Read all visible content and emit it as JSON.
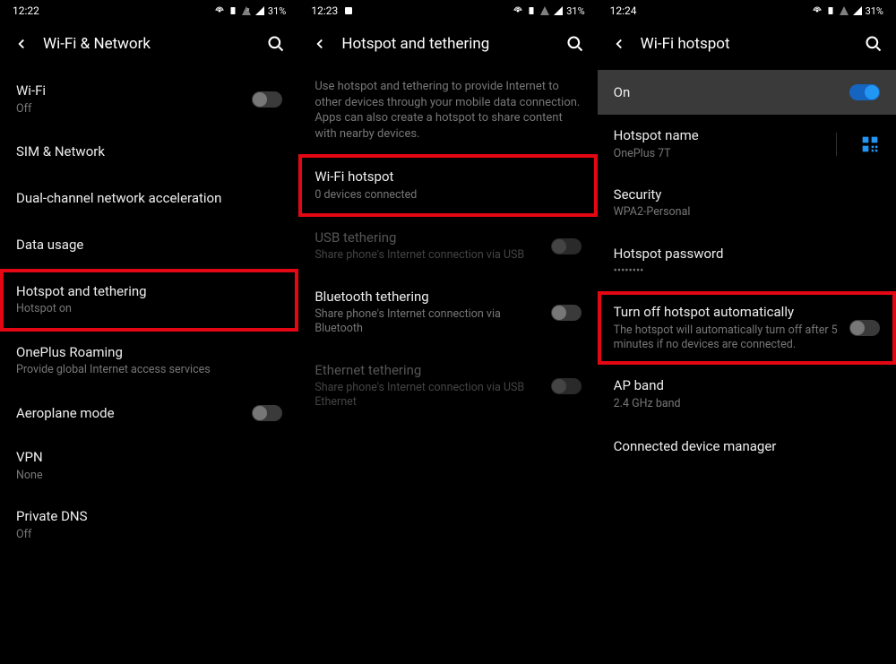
{
  "phone1": {
    "time": "12:22",
    "battery": "31%",
    "title": "Wi-Fi & Network",
    "items": [
      {
        "title": "Wi-Fi",
        "sub": "Off",
        "toggle": "off"
      },
      {
        "title": "SIM & Network"
      },
      {
        "title": "Dual-channel network acceleration"
      },
      {
        "title": "Data usage"
      },
      {
        "title": "Hotspot and tethering",
        "sub": "Hotspot on",
        "highlight": true
      },
      {
        "title": "OnePlus Roaming",
        "sub": "Provide global Internet access services"
      },
      {
        "title": "Aeroplane mode",
        "toggle": "off"
      },
      {
        "title": "VPN",
        "sub": "None"
      },
      {
        "title": "Private DNS",
        "sub": "Off"
      }
    ]
  },
  "phone2": {
    "time": "12:23",
    "battery": "31%",
    "title": "Hotspot and tethering",
    "desc": "Use hotspot and tethering to provide Internet to other devices through your mobile data connection. Apps can also create a hotspot to share content with nearby devices.",
    "items": [
      {
        "title": "Wi-Fi hotspot",
        "sub": "0 devices connected",
        "highlight": true
      },
      {
        "title": "USB tethering",
        "sub": "Share phone's Internet connection via USB",
        "toggle": "off",
        "disabled": true
      },
      {
        "title": "Bluetooth tethering",
        "sub": "Share phone's Internet connection via Bluetooth",
        "toggle": "off"
      },
      {
        "title": "Ethernet tethering",
        "sub": "Share phone's Internet connection via USB Ethernet",
        "toggle": "off",
        "disabled": true
      }
    ]
  },
  "phone3": {
    "time": "12:24",
    "battery": "31%",
    "title": "Wi-Fi hotspot",
    "banner": {
      "title": "On",
      "toggle": "on"
    },
    "items": [
      {
        "title": "Hotspot name",
        "sub": "OnePlus 7T",
        "qr": true
      },
      {
        "title": "Security",
        "sub": "WPA2-Personal"
      },
      {
        "title": "Hotspot password",
        "sub": "••••••••"
      },
      {
        "title": "Turn off hotspot automatically",
        "sub": "The hotspot will automatically turn off after 5 minutes if no devices are connected.",
        "toggle": "off",
        "highlight": true
      },
      {
        "title": "AP band",
        "sub": "2.4 GHz band"
      },
      {
        "title": "Connected device manager"
      }
    ]
  }
}
